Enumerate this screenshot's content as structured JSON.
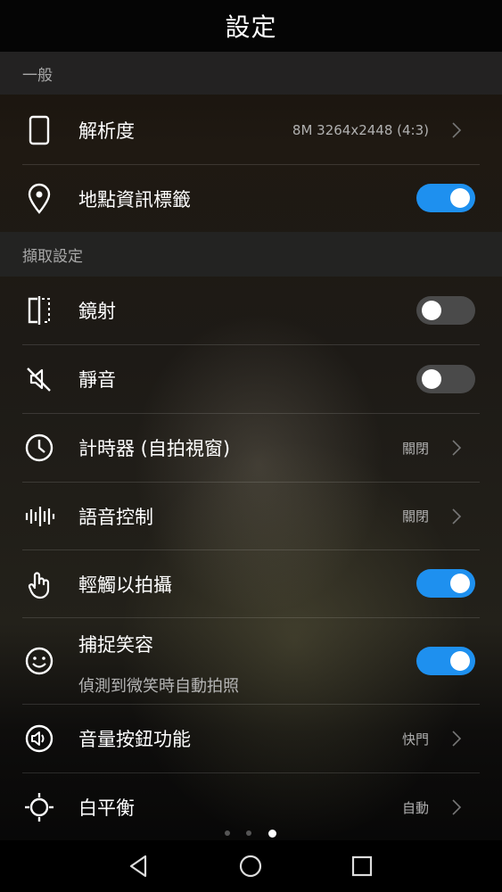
{
  "header": {
    "title": "設定"
  },
  "sections": {
    "general": "一般",
    "capture": "擷取設定"
  },
  "rows": {
    "resolution": {
      "label": "解析度",
      "value": "8M 3264x2448 (4:3)",
      "icon": "phone-outline-icon"
    },
    "location_tag": {
      "label": "地點資訊標籤",
      "toggle": "on",
      "icon": "location-pin-icon"
    },
    "mirror": {
      "label": "鏡射",
      "toggle": "off",
      "icon": "mirror-icon"
    },
    "mute": {
      "label": "靜音",
      "toggle": "off",
      "icon": "speaker-muted-icon"
    },
    "timer": {
      "label": "計時器 (自拍視窗)",
      "value": "關閉",
      "icon": "clock-icon"
    },
    "voice_control": {
      "label": "語音控制",
      "value": "關閉",
      "icon": "sound-wave-icon"
    },
    "touch_capture": {
      "label": "輕觸以拍攝",
      "toggle": "on",
      "icon": "touch-hand-icon"
    },
    "smile_capture": {
      "label": "捕捉笑容",
      "sublabel": "偵測到微笑時自動拍照",
      "toggle": "on",
      "icon": "smile-face-icon"
    },
    "volume_key": {
      "label": "音量按鈕功能",
      "value": "快門",
      "icon": "volume-icon"
    },
    "white_balance": {
      "label": "白平衡",
      "value": "自動",
      "icon": "sun-icon"
    }
  },
  "pager": {
    "pages": 3,
    "active": 3
  },
  "colors": {
    "accent": "#1e90ef",
    "toggle_off": "#4a4a4a",
    "section_bg": "#232323"
  }
}
